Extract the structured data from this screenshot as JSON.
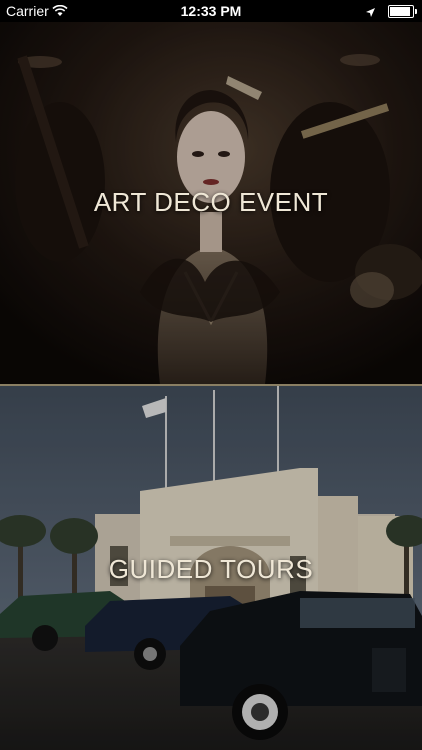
{
  "status_bar": {
    "carrier": "Carrier",
    "time": "12:33 PM"
  },
  "tiles": {
    "event": {
      "label": "ART DECO EVENT"
    },
    "tours": {
      "label": "GUIDED TOURS"
    }
  },
  "colors": {
    "divider": "#8a7f63",
    "label": "#efe7d6"
  }
}
